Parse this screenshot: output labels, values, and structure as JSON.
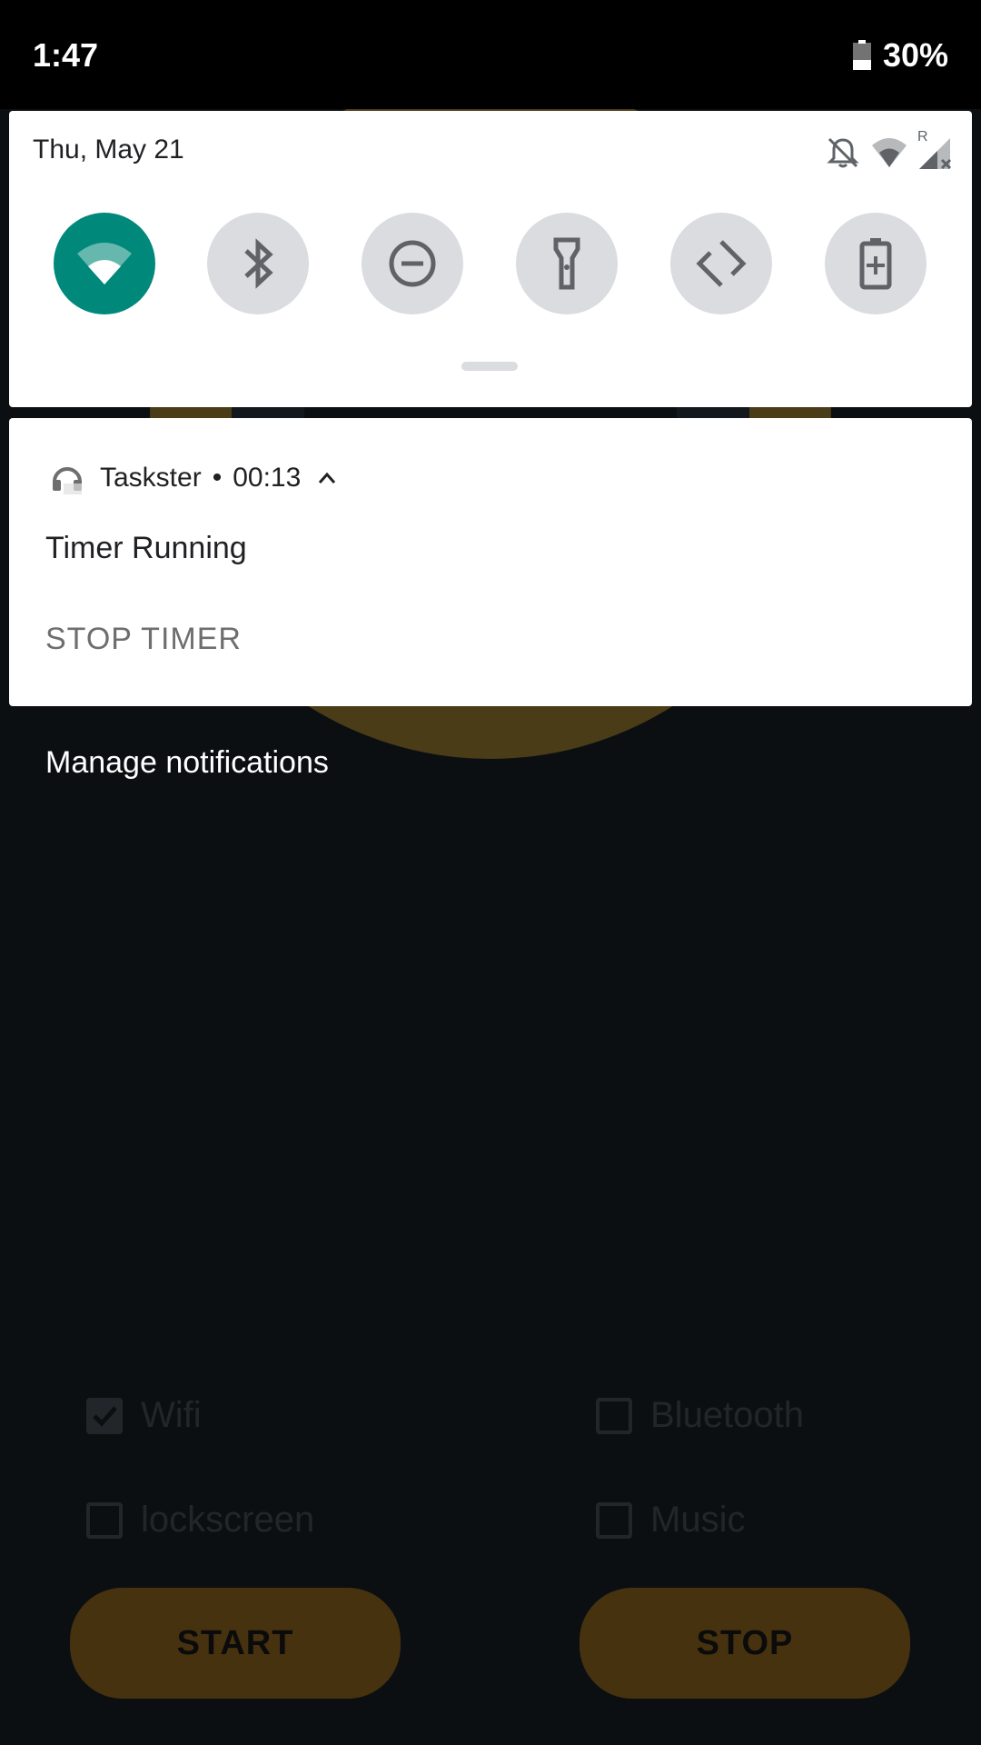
{
  "status_bar": {
    "time": "1:47",
    "battery": "30%"
  },
  "quick_settings": {
    "date": "Thu, May 21",
    "roaming_label": "R",
    "tiles": [
      {
        "icon": "wifi-icon",
        "active": true
      },
      {
        "icon": "bluetooth-icon",
        "active": false
      },
      {
        "icon": "do-not-disturb-icon",
        "active": false
      },
      {
        "icon": "flashlight-icon",
        "active": false
      },
      {
        "icon": "auto-rotate-icon",
        "active": false
      },
      {
        "icon": "battery-saver-icon",
        "active": false
      }
    ]
  },
  "notification": {
    "app_name": "Taskster",
    "separator": "•",
    "elapsed": "00:13",
    "title": "Timer Running",
    "action": "STOP TIMER"
  },
  "manage_label": "Manage notifications",
  "app": {
    "checkboxes": [
      {
        "label": "Wifi",
        "checked": true
      },
      {
        "label": "Bluetooth",
        "checked": false
      },
      {
        "label": "lockscreen",
        "checked": false
      },
      {
        "label": "Music",
        "checked": false
      }
    ],
    "start_label": "START",
    "stop_label": "STOP",
    "accent": "#4a3c17"
  }
}
